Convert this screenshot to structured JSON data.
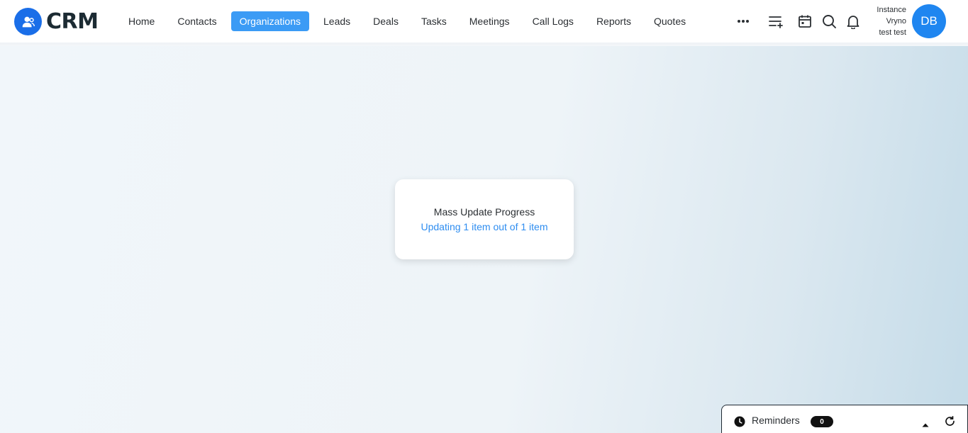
{
  "app": {
    "logo_text": "CRM"
  },
  "nav": {
    "items": [
      {
        "label": "Home"
      },
      {
        "label": "Contacts"
      },
      {
        "label": "Organizations"
      },
      {
        "label": "Leads"
      },
      {
        "label": "Deals"
      },
      {
        "label": "Tasks"
      },
      {
        "label": "Meetings"
      },
      {
        "label": "Call Logs"
      },
      {
        "label": "Reports"
      },
      {
        "label": "Quotes"
      }
    ],
    "active": "Organizations"
  },
  "toolbar": {
    "icons": [
      "more-icon",
      "add-list-icon",
      "calendar-icon",
      "search-icon",
      "bell-icon"
    ]
  },
  "user": {
    "instance_line1": "Instance",
    "instance_line2": "Vryno",
    "instance_line3": "test test",
    "initials": "DB"
  },
  "progress": {
    "title": "Mass Update Progress",
    "status": "Updating 1 item out of 1 item"
  },
  "reminders": {
    "label": "Reminders",
    "count": "0"
  },
  "colors": {
    "accent": "#3b9bf5",
    "avatar": "#1f86f0",
    "logo": "#1a6ee8",
    "status_text": "#2e8df0"
  }
}
